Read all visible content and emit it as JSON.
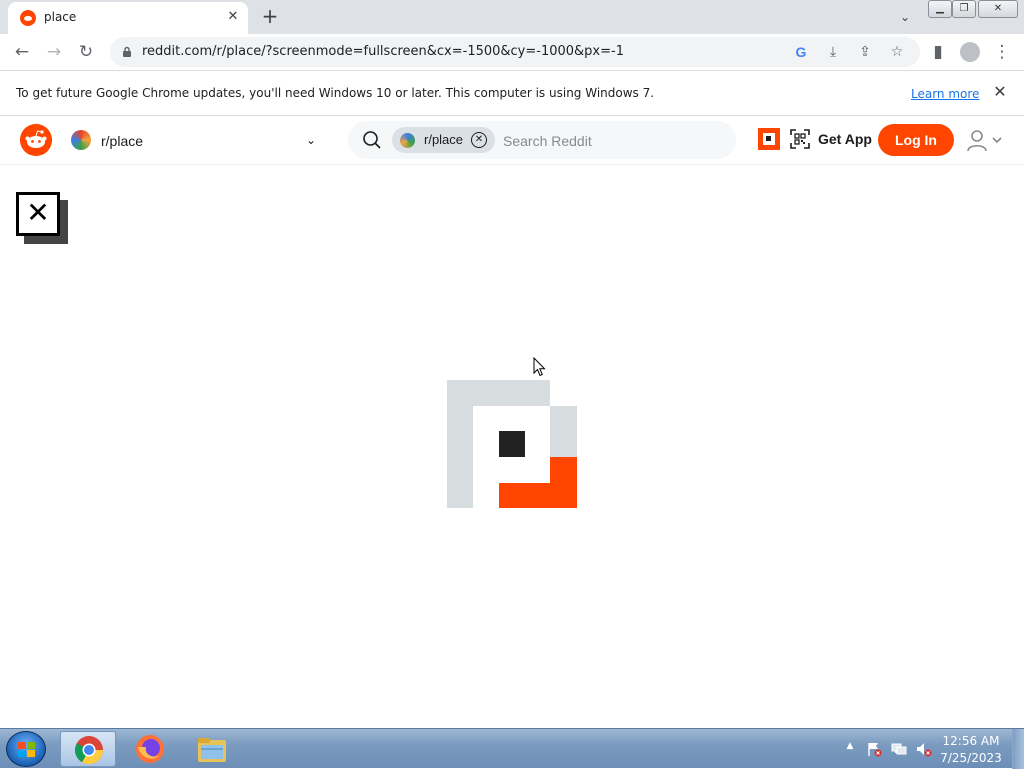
{
  "browser": {
    "tab_title": "place",
    "url": "reddit.com/r/place/?screenmode=fullscreen&cx=-1500&cy=-1000&px=-1",
    "infobar_text": "To get future Google Chrome updates, you'll need Windows 10 or later. This computer is using Windows 7.",
    "infobar_link": "Learn more"
  },
  "reddit": {
    "community": "r/place",
    "search_chip": "r/place",
    "search_placeholder": "Search Reddit",
    "get_app": "Get App",
    "login": "Log In",
    "accent_color": "#ff4500"
  },
  "taskbar": {
    "time": "12:56 AM",
    "date": "7/25/2023"
  },
  "icons": {
    "close_fullscreen": "close-icon",
    "loader": "place-logo-icon"
  }
}
